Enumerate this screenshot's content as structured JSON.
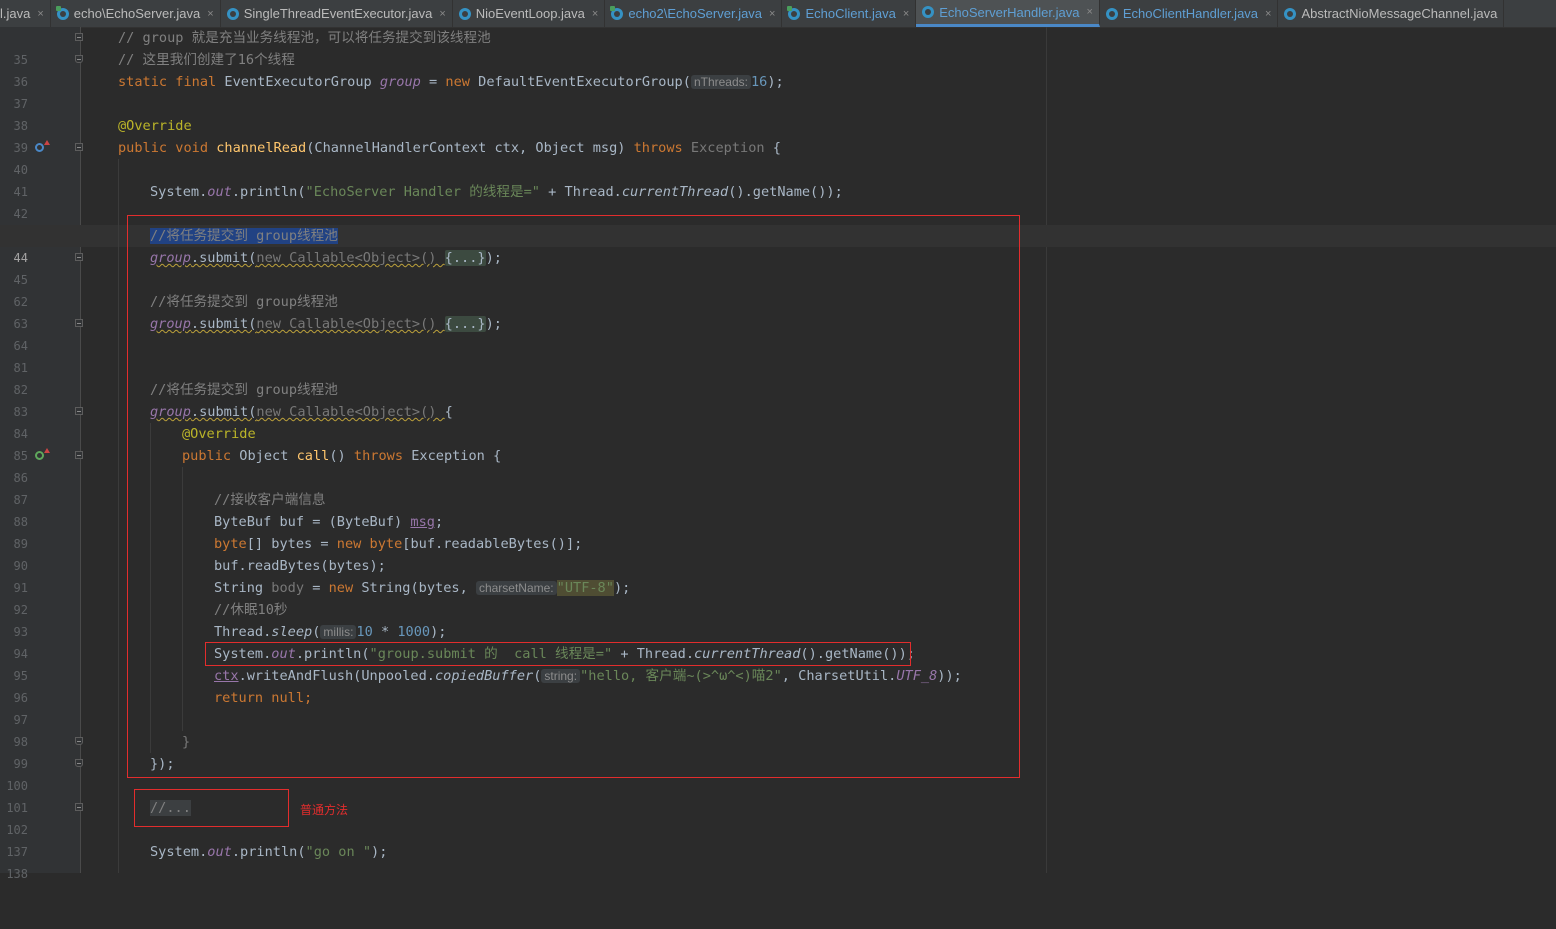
{
  "tabs": [
    {
      "label": "l.java",
      "icon": "class-icon",
      "modified": false,
      "active": false,
      "color": "default"
    },
    {
      "label": "echo\\EchoServer.java",
      "icon": "class-icon",
      "modified": true,
      "active": false,
      "color": "default"
    },
    {
      "label": "SingleThreadEventExecutor.java",
      "icon": "class-icon",
      "modified": false,
      "active": false,
      "color": "default"
    },
    {
      "label": "NioEventLoop.java",
      "icon": "class-icon",
      "modified": false,
      "active": false,
      "color": "default"
    },
    {
      "label": "echo2\\EchoServer.java",
      "icon": "class-icon",
      "modified": true,
      "active": false,
      "color": "blue"
    },
    {
      "label": "EchoClient.java",
      "icon": "class-icon",
      "modified": true,
      "active": false,
      "color": "blue"
    },
    {
      "label": "EchoServerHandler.java",
      "icon": "class-icon",
      "modified": false,
      "active": true,
      "color": "blue"
    },
    {
      "label": "EchoClientHandler.java",
      "icon": "class-icon",
      "modified": false,
      "active": false,
      "color": "blue"
    },
    {
      "label": "AbstractNioMessageChannel.java",
      "icon": "class-icon",
      "modified": false,
      "active": false,
      "color": "default"
    }
  ],
  "tab_close_glyph": "×",
  "line_numbers": [
    "35",
    "36",
    "37",
    "38",
    "39",
    "40",
    "41",
    "42",
    "43",
    "44",
    "45",
    "62",
    "63",
    "64",
    "81",
    "82",
    "83",
    "84",
    "85",
    "86",
    "87",
    "88",
    "89",
    "90",
    "91",
    "92",
    "93",
    "94",
    "95",
    "96",
    "97",
    "98",
    "99",
    "100",
    "101",
    "102",
    "137",
    "138"
  ],
  "code": {
    "l35": "// group 就是充当业务线程池，可以将任务提交到该线程池",
    "l36": "// 这里我们创建了16个线程",
    "l37": {
      "a": "static final ",
      "b": "EventExecutorGroup ",
      "c": "group",
      "d": " = ",
      "e": "new ",
      "f": "DefaultEventExecutorGroup(",
      "hint": "nThreads:",
      "num": "16",
      "g": ");"
    },
    "l39": "@Override",
    "l40": {
      "a": "public void ",
      "b": "channelRead",
      "c": "(ChannelHandlerContext ctx, Object msg) ",
      "d": "throws ",
      "e": "Exception",
      "f": " {"
    },
    "l42": {
      "a": "System.",
      "b": "out",
      "c": ".println(",
      "d": "\"EchoServer Handler 的线程是=\"",
      "e": " + Thread.",
      "f": "currentThread",
      "g": "().getName());"
    },
    "l44": "//将任务提交到 group线程池",
    "l45": {
      "a": "group",
      "b": ".submit(",
      "c": "new Callable<Object>() ",
      "d": "{...}",
      "e": ");"
    },
    "l63": "//将任务提交到 group线程池",
    "l64": {
      "a": "group",
      "b": ".submit(",
      "c": "new Callable<Object>() ",
      "d": "{...}",
      "e": ");"
    },
    "l83": "//将任务提交到 group线程池",
    "l84": {
      "a": "group",
      "b": ".submit(",
      "c": "new Callable<Object>() ",
      "d": "{"
    },
    "l85": "@Override",
    "l86": {
      "a": "public ",
      "b": "Object ",
      "c": "call",
      "d": "() ",
      "e": "throws ",
      "f": "Exception ",
      "g": "{"
    },
    "l88": "//接收客户端信息",
    "l89": {
      "a": "ByteBuf buf = (ByteBuf) ",
      "b": "msg",
      "c": ";"
    },
    "l90": {
      "a": "byte",
      "b": "[] bytes = ",
      "c": "new ",
      "d": "byte",
      "e": "[buf.readableBytes()];"
    },
    "l91": "buf.readBytes(bytes);",
    "l92": {
      "a": "String ",
      "b": "body",
      "c": " = ",
      "d": "new ",
      "e": "String(bytes, ",
      "hint": "charsetName:",
      "f": "\"UTF-8\"",
      "g": ");"
    },
    "l93": "//休眠10秒",
    "l94": {
      "a": "Thread.",
      "b": "sleep",
      "c": "(",
      "hint": "millis:",
      "d": "10",
      "e": " * ",
      "f": "1000",
      "g": ");"
    },
    "l95": {
      "a": "System.",
      "b": "out",
      "c": ".println(",
      "d": "\"group.submit 的  call 线程是=\"",
      "e": " + Thread.",
      "f": "currentThread",
      "g": "().getName());"
    },
    "l96": {
      "a": "ctx",
      "b": ".writeAndFlush(Unpooled.",
      "c": "copiedBuffer",
      "d": "(",
      "hint": "string:",
      "e": "\"hello, 客户端~(>^ω^<)喵2\"",
      "f": ", CharsetUtil.",
      "g": "UTF_8",
      "h": "));"
    },
    "l97": {
      "a": "return null",
      "b": ";"
    },
    "l99": "}",
    "l100": "});",
    "l102": "//...",
    "l138": {
      "a": "System.",
      "b": "out",
      "c": ".println(",
      "d": "\"go on \"",
      "e": ");"
    }
  },
  "annotations": {
    "note_label": "普通方法"
  },
  "colors": {
    "background": "#2b2b2b",
    "gutter": "#313335",
    "keyword": "#cc7832",
    "string": "#6a8759",
    "number": "#6897bb",
    "comment": "#808080",
    "method": "#ffc66d",
    "field": "#9876aa",
    "annotation": "#bbb529",
    "redbox": "#e22d2d",
    "active_tab": "#5f9fd4"
  }
}
